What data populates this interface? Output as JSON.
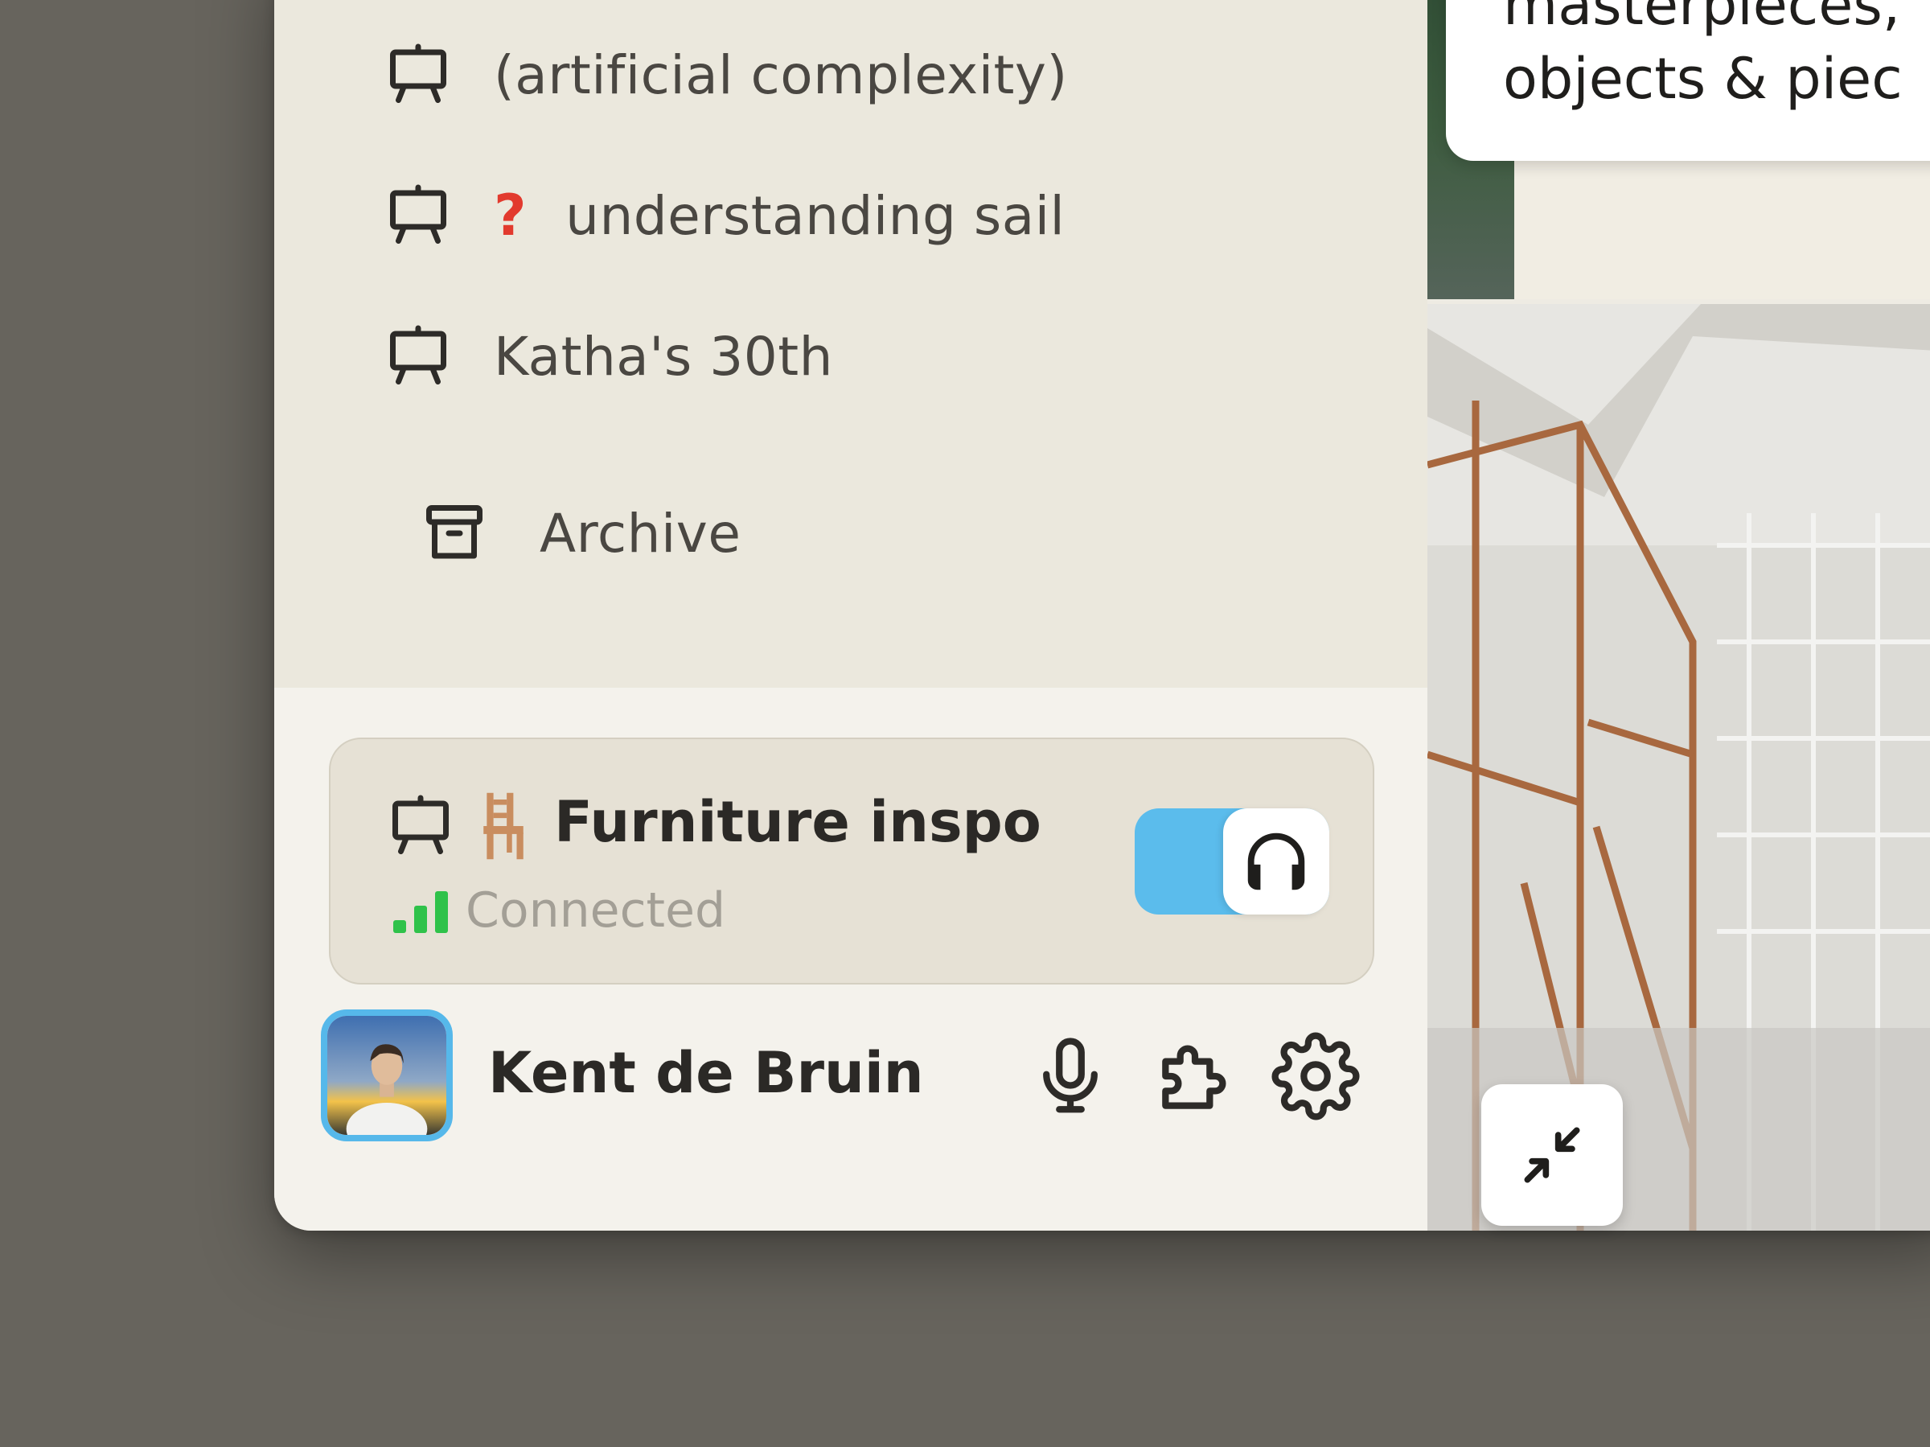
{
  "sidebar": {
    "items": [
      {
        "label": "… … …"
      },
      {
        "label": "(artificial complexity)"
      },
      {
        "label": "understanding sail",
        "prefix": "❓"
      },
      {
        "label": "Katha's 30th"
      }
    ],
    "archive_label": "Archive"
  },
  "call": {
    "title": "Furniture inspo",
    "status": "Connected",
    "headphones_on": true
  },
  "user": {
    "name": "Kent de Bruin"
  },
  "canvas": {
    "note_lines": [
      "masterpieces,",
      "objects & piec"
    ]
  },
  "colors": {
    "sidebar_bg": "#ebe8dd",
    "footer_bg": "#f4f2ec",
    "accent": "#5bbcec",
    "signal": "#2fc24a",
    "question": "#e23a2e"
  }
}
